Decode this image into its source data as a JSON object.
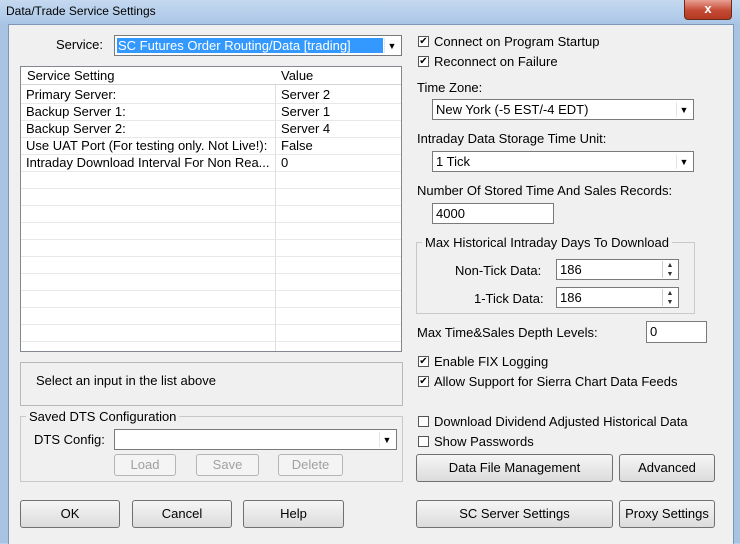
{
  "window": {
    "title": "Data/Trade Service Settings",
    "close_label": "x"
  },
  "service": {
    "label": "Service:",
    "value": "SC Futures Order Routing/Data     [trading]"
  },
  "grid": {
    "headers": [
      "Service Setting",
      "Value"
    ],
    "rows": [
      [
        "Primary Server:",
        "Server 2"
      ],
      [
        "Backup Server 1:",
        "Server 1"
      ],
      [
        "Backup Server 2:",
        "Server 4"
      ],
      [
        "Use UAT Port (For testing only. Not Live!):",
        "False"
      ],
      [
        "Intraday Download Interval For Non Rea...",
        "0"
      ]
    ]
  },
  "help_text": "Select an input in the list above",
  "saved_dts": {
    "group_label": "Saved DTS Configuration",
    "config_label": "DTS Config:",
    "config_value": "",
    "load": "Load",
    "save": "Save",
    "delete": "Delete"
  },
  "bottom_buttons": {
    "ok": "OK",
    "cancel": "Cancel",
    "help": "Help"
  },
  "right": {
    "connect_on_startup": {
      "label": "Connect on Program Startup",
      "checked": true
    },
    "reconnect_on_failure": {
      "label": "Reconnect on Failure",
      "checked": true
    },
    "time_zone": {
      "label": "Time Zone:",
      "value": "New York (-5 EST/-4 EDT)"
    },
    "storage_unit": {
      "label": "Intraday Data Storage Time Unit:",
      "value": "1 Tick"
    },
    "stored_records": {
      "label": "Number Of Stored Time And Sales Records:",
      "value": "4000"
    },
    "max_days": {
      "group_label": "Max Historical Intraday Days To Download",
      "non_tick_label": "Non-Tick Data:",
      "non_tick_value": "186",
      "one_tick_label": "1-Tick Data:",
      "one_tick_value": "186"
    },
    "depth_levels": {
      "label": "Max Time&Sales Depth Levels:",
      "value": "0"
    },
    "enable_fix_logging": {
      "label": "Enable FIX Logging",
      "checked": true
    },
    "allow_sierra_feeds": {
      "label": "Allow Support for Sierra Chart Data Feeds",
      "checked": true
    },
    "dividend_adjusted": {
      "label": "Download Dividend Adjusted Historical Data",
      "checked": false
    },
    "show_passwords": {
      "label": "Show Passwords",
      "checked": false
    },
    "data_file_mgmt": "Data File Management",
    "advanced": "Advanced",
    "sc_server_settings": "SC Server Settings",
    "proxy_settings": "Proxy Settings"
  },
  "icons": {
    "checkmark": "check-glyph",
    "dropdown": "triangle-down-glyph"
  }
}
